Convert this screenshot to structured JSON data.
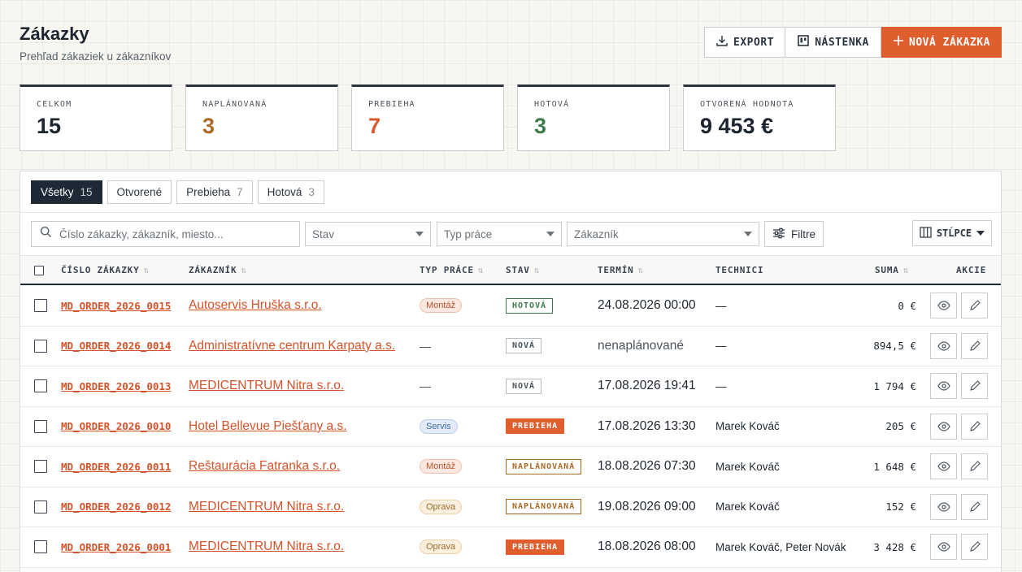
{
  "header": {
    "title": "Zákazky",
    "subtitle": "Prehľad zákaziek u zákazníkov",
    "export_label": "EXPORT",
    "board_label": "NÁSTENKA",
    "new_label": "NOVÁ ZÁKAZKA"
  },
  "stats": [
    {
      "label": "CELKOM",
      "value": "15",
      "color": "#1d2630"
    },
    {
      "label": "NAPLÁNOVANÁ",
      "value": "3",
      "color": "#a86a26"
    },
    {
      "label": "PREBIEHA",
      "value": "7",
      "color": "#d9592e"
    },
    {
      "label": "HOTOVÁ",
      "value": "3",
      "color": "#3d7a4a"
    },
    {
      "label": "OTVORENÁ HODNOTA",
      "value": "9 453 €",
      "color": "#1d2630"
    }
  ],
  "tabs": [
    {
      "label": "Všetky",
      "count": "15",
      "active": true
    },
    {
      "label": "Otvorené",
      "count": ""
    },
    {
      "label": "Prebieha",
      "count": "7"
    },
    {
      "label": "Hotová",
      "count": "3"
    }
  ],
  "filters": {
    "search_placeholder": "Číslo zákazky, zákazník, miesto...",
    "status_placeholder": "Stav",
    "worktype_placeholder": "Typ práce",
    "customer_placeholder": "Zákazník",
    "filter_label": "Filtre",
    "columns_label": "STĹPCE"
  },
  "table": {
    "headers": {
      "order": "ČÍSLO ZÁKAZKY",
      "customer": "ZÁKAZNÍK",
      "worktype": "TYP PRÁCE",
      "status": "STAV",
      "term": "TERMÍN",
      "techs": "TECHNICI",
      "sum": "SUMA",
      "actions": "AKCIE"
    },
    "rows": [
      {
        "order": "MD_ORDER_2026_0015",
        "customer": "Autoservis Hruška s.r.o.",
        "worktype": "Montáž",
        "status": "HOTOVÁ",
        "term": "24.08.2026 00:00",
        "techs": "—",
        "sum": "0 €"
      },
      {
        "order": "MD_ORDER_2026_0014",
        "customer": "Administratívne centrum Karpaty a.s.",
        "worktype": "—",
        "status": "NOVÁ",
        "term": "nenaplánované",
        "techs": "—",
        "sum": "894,5 €"
      },
      {
        "order": "MD_ORDER_2026_0013",
        "customer": "MEDICENTRUM Nitra s.r.o.",
        "worktype": "—",
        "status": "NOVÁ",
        "term": "17.08.2026 19:41",
        "techs": "—",
        "sum": "1 794 €"
      },
      {
        "order": "MD_ORDER_2026_0010",
        "customer": "Hotel Bellevue Piešťany a.s.",
        "worktype": "Servis",
        "status": "PREBIEHA",
        "term": "17.08.2026 13:30",
        "techs": "Marek Kováč",
        "sum": "205 €"
      },
      {
        "order": "MD_ORDER_2026_0011",
        "customer": "Reštaurácia Fatranka s.r.o.",
        "worktype": "Montáž",
        "status": "NAPLÁNOVANÁ",
        "term": "18.08.2026 07:30",
        "techs": "Marek Kováč",
        "sum": "1 648 €"
      },
      {
        "order": "MD_ORDER_2026_0012",
        "customer": "MEDICENTRUM Nitra s.r.o.",
        "worktype": "Oprava",
        "status": "NAPLÁNOVANÁ",
        "term": "19.08.2026 09:00",
        "techs": "Marek Kováč",
        "sum": "152 €"
      },
      {
        "order": "MD_ORDER_2026_0001",
        "customer": "MEDICENTRUM Nitra s.r.o.",
        "worktype": "Oprava",
        "status": "PREBIEHA",
        "term": "18.08.2026 08:00",
        "techs": "Marek Kováč, Peter Novák",
        "sum": "3 428 €"
      }
    ]
  },
  "icons": [
    "download-icon",
    "board-icon",
    "plus-icon",
    "search-icon",
    "sliders-icon",
    "columns-icon",
    "eye-icon",
    "pencil-icon",
    "sort-icon"
  ],
  "colors": {
    "accent": "#e05d2e",
    "link": "#d4532a",
    "dark": "#1d2a36",
    "planned": "#a86a26",
    "done": "#3d7a4a"
  }
}
